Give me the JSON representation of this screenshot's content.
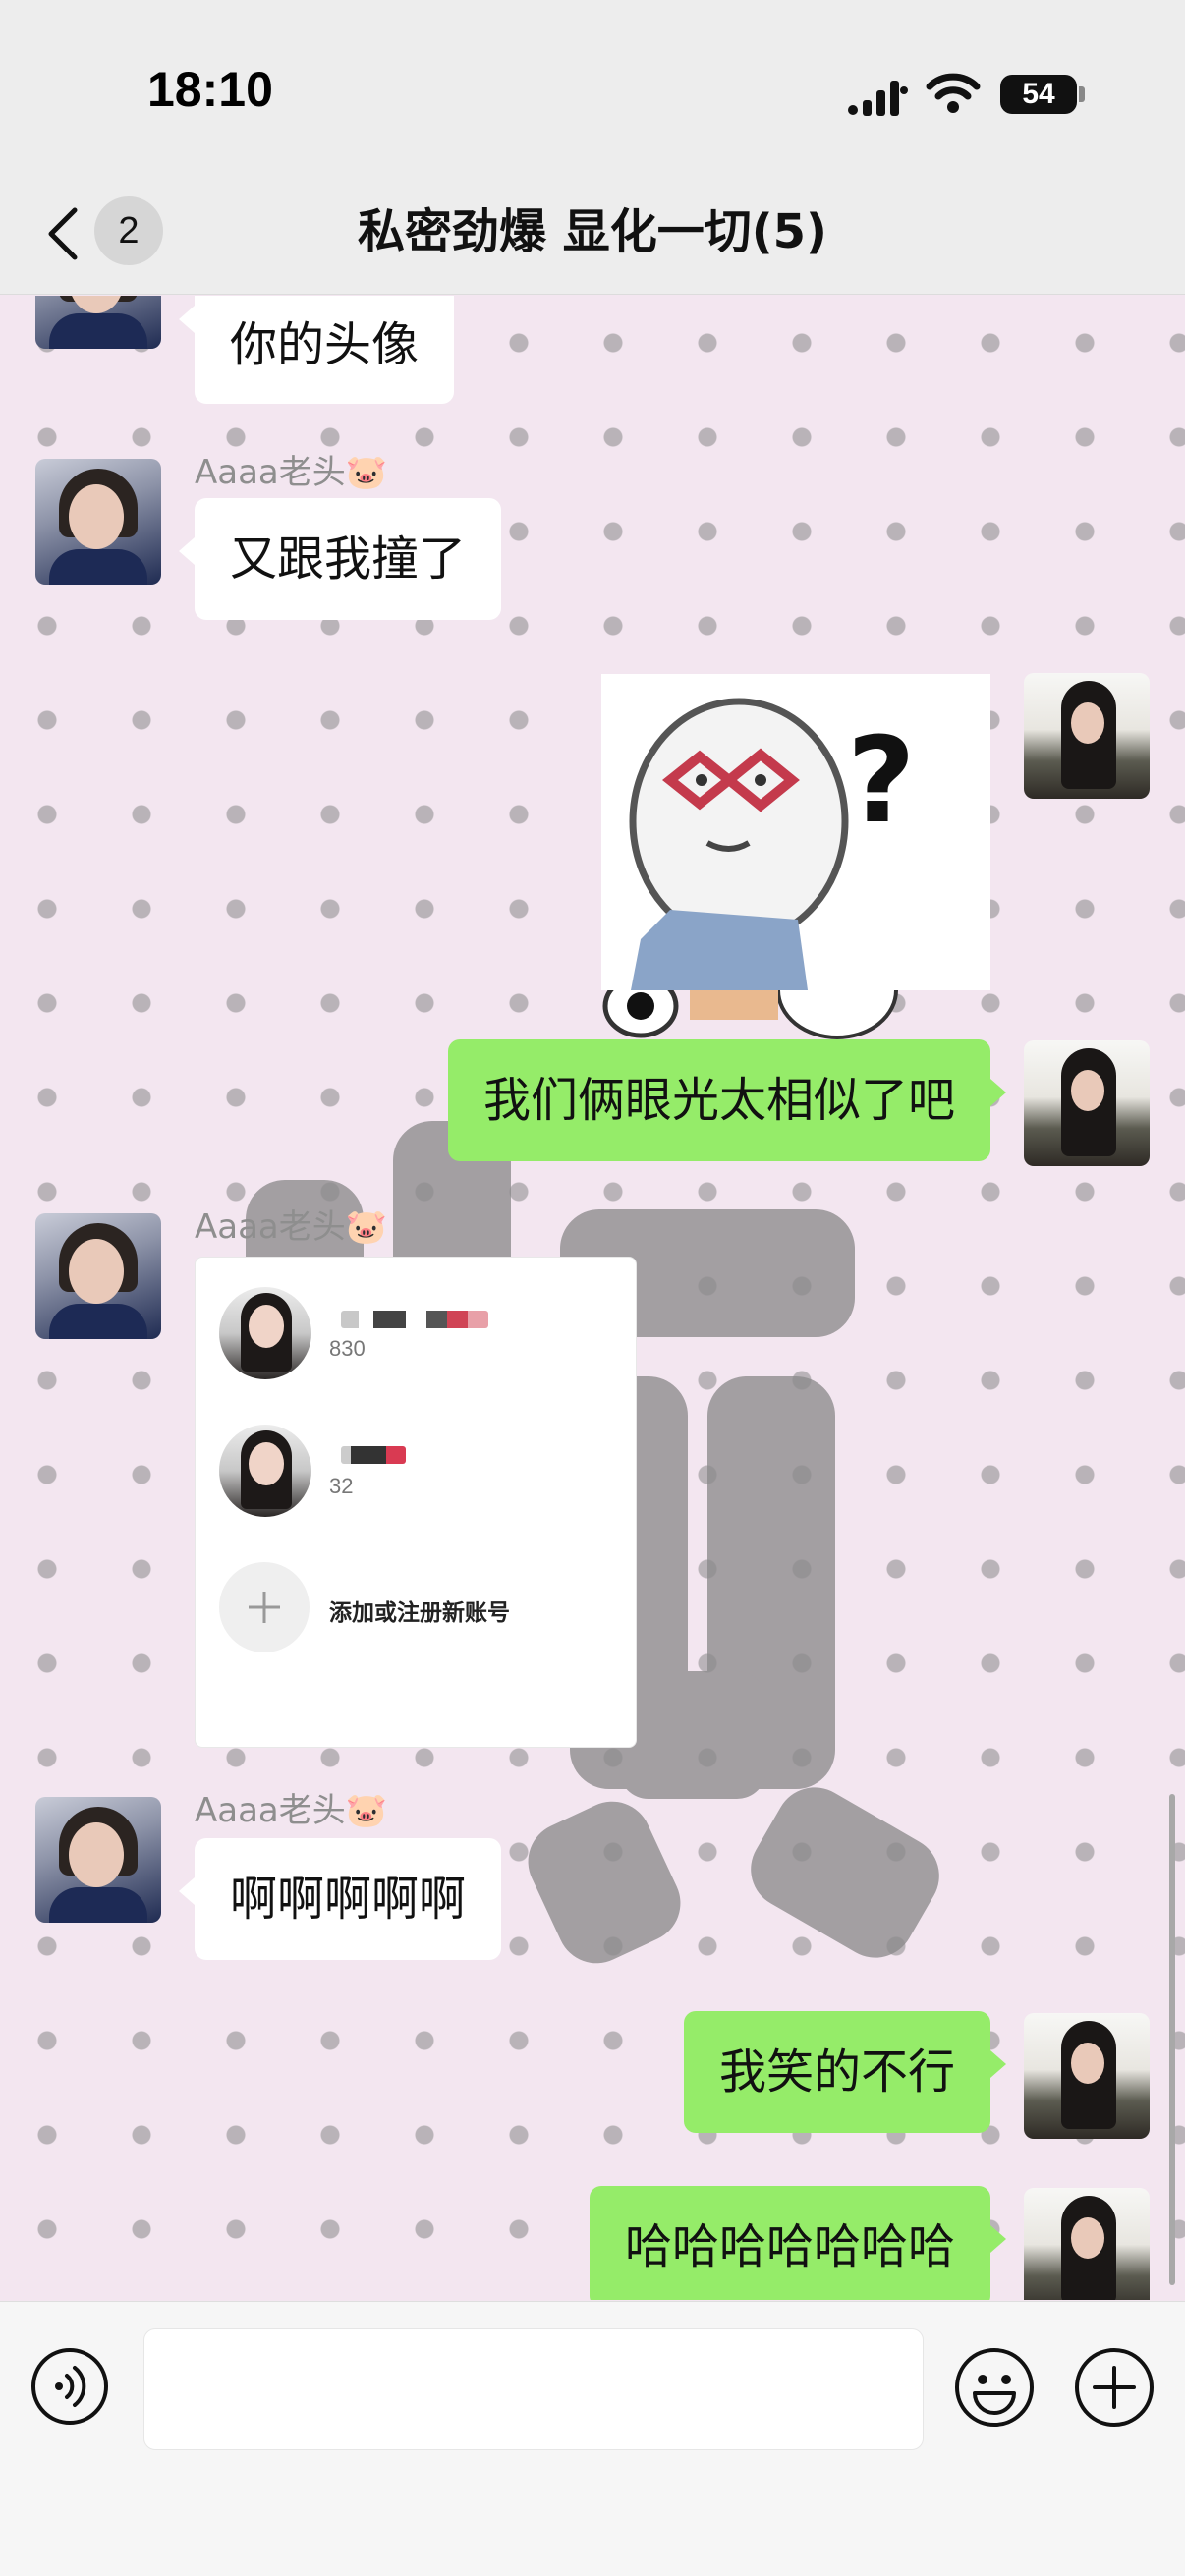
{
  "status": {
    "time": "18:10",
    "battery": "54"
  },
  "nav": {
    "unread_count": "2",
    "title": "私密劲爆 显化一切(5)"
  },
  "messages": [
    {
      "side": "in",
      "text": "你的头像"
    },
    {
      "side": "in",
      "sender": "Aaaa老头🐷",
      "text": "又跟我撞了"
    },
    {
      "side": "out",
      "type": "sticker"
    },
    {
      "side": "out",
      "text": "我们俩眼光太相似了吧"
    },
    {
      "side": "in",
      "sender": "Aaaa老头🐷",
      "type": "image"
    },
    {
      "side": "in",
      "sender": "Aaaa老头🐷",
      "text": "啊啊啊啊啊"
    },
    {
      "side": "out",
      "text": "我笑的不行"
    },
    {
      "side": "out",
      "text": "哈哈哈哈哈哈哈"
    }
  ],
  "account_card": {
    "account1_count": "830",
    "account2_count": "32",
    "add_label": "添加或注册新账号"
  },
  "input": {
    "value": "",
    "placeholder": ""
  }
}
